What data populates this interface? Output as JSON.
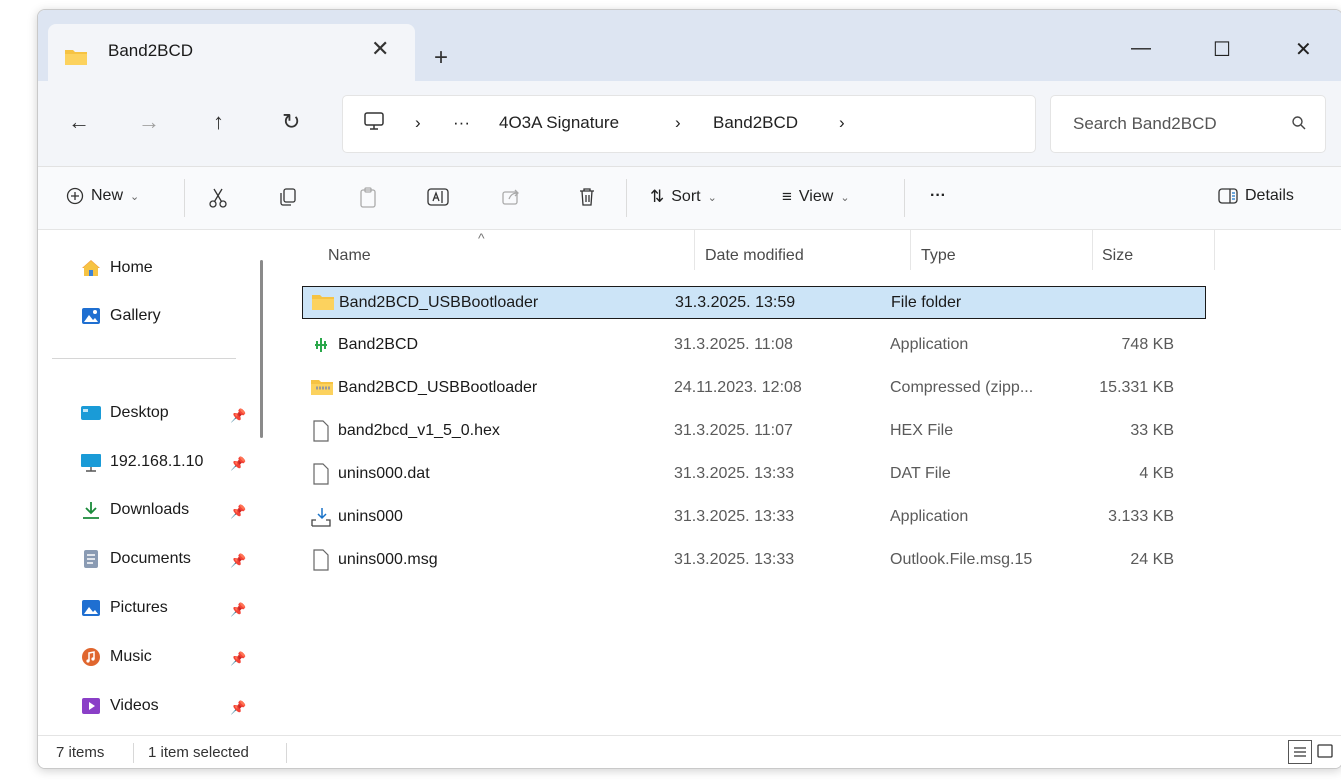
{
  "tab": {
    "title": "Band2BCD",
    "close_glyph": "✕",
    "new_tab_glyph": "+"
  },
  "window_controls": {
    "minimize": "—",
    "maximize": "☐",
    "close": "✕"
  },
  "nav": {
    "back": "←",
    "forward": "→",
    "up": "↑",
    "refresh": "↻"
  },
  "address": {
    "chevron": "›",
    "ellipsis": "···",
    "crumbs": [
      "4O3A Signature",
      "Band2BCD"
    ]
  },
  "search": {
    "placeholder": "Search Band2BCD"
  },
  "toolbar": {
    "new_label": "New",
    "sort_label": "Sort",
    "view_label": "View",
    "more_label": "···",
    "details_label": "Details",
    "caret": "⌄"
  },
  "sidebar": {
    "home": "Home",
    "gallery": "Gallery",
    "quick_access": [
      {
        "label": "Desktop",
        "icon": "desktop-icon"
      },
      {
        "label": "192.168.1.10",
        "icon": "network-drive-icon"
      },
      {
        "label": "Downloads",
        "icon": "downloads-icon"
      },
      {
        "label": "Documents",
        "icon": "documents-icon"
      },
      {
        "label": "Pictures",
        "icon": "pictures-icon"
      },
      {
        "label": "Music",
        "icon": "music-icon"
      },
      {
        "label": "Videos",
        "icon": "videos-icon"
      }
    ],
    "pin_glyph": "📌"
  },
  "columns": {
    "name": "Name",
    "date": "Date modified",
    "type": "Type",
    "size": "Size",
    "sort_indicator": "^"
  },
  "files": [
    {
      "name": "Band2BCD_USBBootloader",
      "date": "31.3.2025. 13:59",
      "type": "File folder",
      "size": "",
      "icon": "folder-icon",
      "selected": true
    },
    {
      "name": "Band2BCD",
      "date": "31.3.2025. 11:08",
      "type": "Application",
      "size": "748 KB",
      "icon": "application-icon",
      "selected": false
    },
    {
      "name": "Band2BCD_USBBootloader",
      "date": "24.11.2023. 12:08",
      "type": "Compressed (zipp...",
      "size": "15.331 KB",
      "icon": "zip-folder-icon",
      "selected": false
    },
    {
      "name": "band2bcd_v1_5_0.hex",
      "date": "31.3.2025. 11:07",
      "type": "HEX File",
      "size": "33 KB",
      "icon": "file-icon",
      "selected": false
    },
    {
      "name": "unins000.dat",
      "date": "31.3.2025. 13:33",
      "type": "DAT File",
      "size": "4 KB",
      "icon": "file-icon",
      "selected": false
    },
    {
      "name": "unins000",
      "date": "31.3.2025. 13:33",
      "type": "Application",
      "size": "3.133 KB",
      "icon": "installer-icon",
      "selected": false
    },
    {
      "name": "unins000.msg",
      "date": "31.3.2025. 13:33",
      "type": "Outlook.File.msg.15",
      "size": "24 KB",
      "icon": "file-icon",
      "selected": false
    }
  ],
  "status": {
    "items": "7 items",
    "selected": "1 item selected"
  },
  "colors": {
    "accent": "#1a73c8",
    "selection": "#cce4f7",
    "folder": "#f6c343",
    "titlebar": "#dde5f2"
  }
}
